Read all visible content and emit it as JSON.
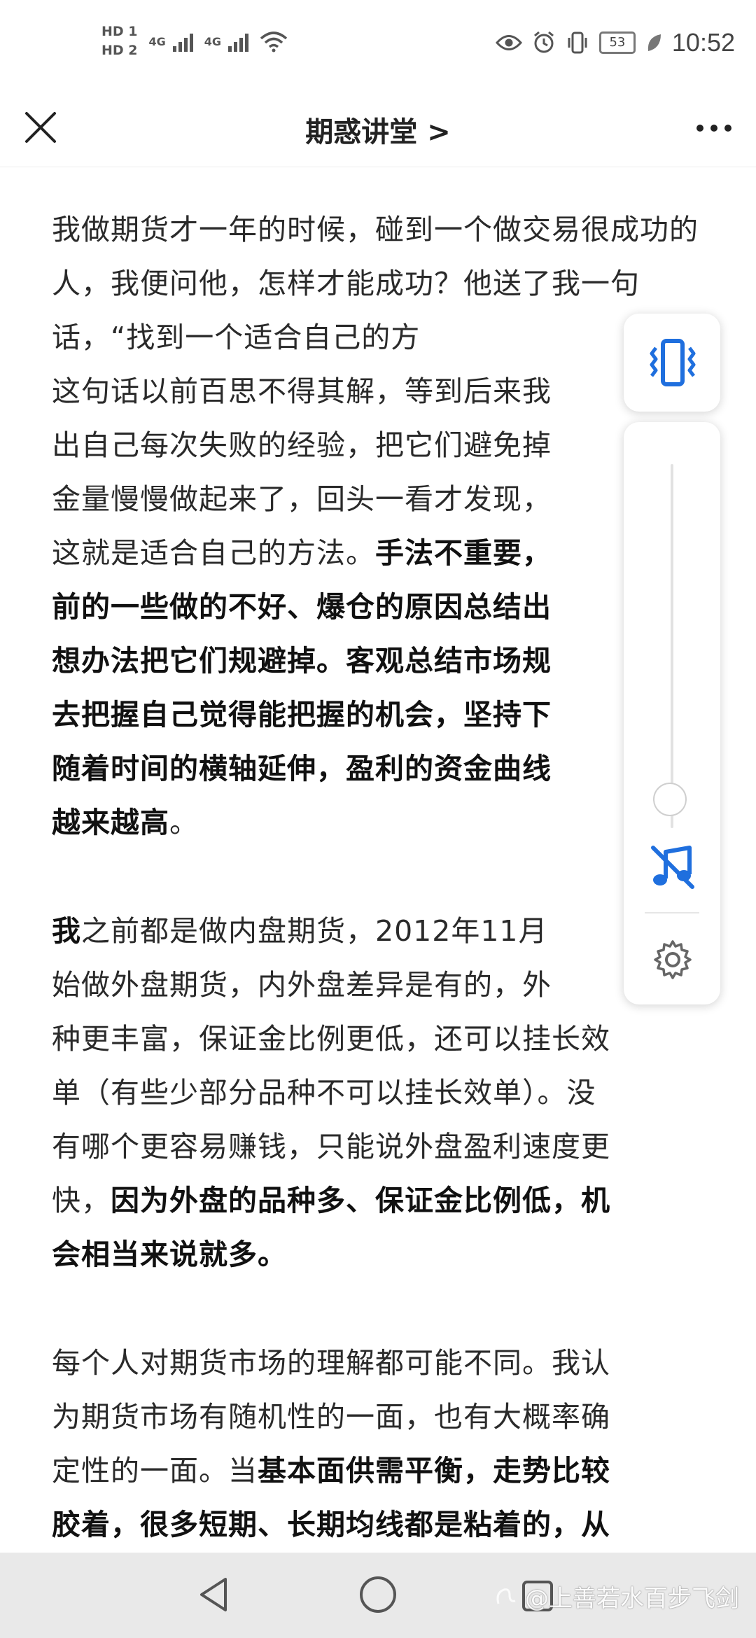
{
  "status_bar": {
    "sim1": "HD 1",
    "sim2": "HD 2",
    "net1": "4G",
    "net2": "4G",
    "battery": "53",
    "time": "10:52"
  },
  "header": {
    "title": "期惑讲堂 >"
  },
  "article": {
    "p1_normal": "我做期货才一年的时候，碰到一个做交易很成功的人，我便问他，怎样才能成功？他送了我一句话，“找到一个适合自己的方",
    "p1_line4": "这句话以前百思不得其解，等到后来我",
    "p1_line5": "出自己每次失败的经验，把它们避免掉",
    "p1_line6": "金量慢慢做起来了，回头一看才发现，",
    "p1_line7": "这就是适合自己的方法。",
    "p1_bold1": "手法不重要，",
    "p1_bold2": "前的一些做的不好、爆仓的原因总结出",
    "p1_bold3": "想办法把它们规避掉。客观总结市场规",
    "p1_bold4": "去把握自己觉得能把握的机会，坚持下",
    "p1_bold5": "随着时间的横轴延伸，盈利的资金曲线",
    "p1_bold6": "越来越高",
    "p1_end": "。",
    "p2_bold_lead": "我",
    "p2_line1": "之前都是做内盘期货，2012年11月",
    "p2_line2": "始做外盘期货，内外盘差异是有的，外",
    "p2_line3": "种更丰富，保证金比例更低，还可以挂长效",
    "p2_line4": "单（有些少部分品种不可以挂长效单）。没",
    "p2_line5": "有哪个更容易赚钱，只能说外盘盈利速度更",
    "p2_line6a": "快，",
    "p2_bold1": "因为外盘的品种多、保证金比例低，机",
    "p2_bold2": "会相当来说就多。",
    "p3_line1": "每个人对期货市场的理解都可能不同。我认",
    "p3_line2": "为期货市场有随机性的一面，也有大概率确",
    "p3_line3a": "定性的一面。当",
    "p3_bold1": "基本面供需平衡，走势比较",
    "p3_bold2": "胶着，很多短期、长期均线都是粘着的，从"
  },
  "float_widgets": {
    "vibrate_icon": "vibrate-icon",
    "volume_level": 0.1,
    "music_off_icon": "music-off-icon",
    "settings_icon": "gear-icon"
  },
  "watermark": {
    "text": "@上善若水百步飞剑"
  },
  "colors": {
    "accent": "#1f6fde",
    "navbar": "#e9e9e9"
  }
}
